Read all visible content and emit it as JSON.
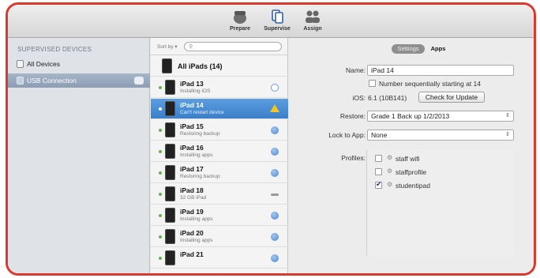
{
  "toolbar": {
    "prepare": "Prepare",
    "supervise": "Supervise",
    "assign": "Assign"
  },
  "sidebar": {
    "header": "SUPERVISED DEVICES",
    "items": [
      {
        "label": "All Devices",
        "icon": "ipad-icon",
        "selected": false
      },
      {
        "label": "USB Connection",
        "icon": "usb-icon",
        "selected": true
      }
    ]
  },
  "device_list": {
    "sort_label": "Sort by ▾",
    "search_placeholder": "",
    "header_row": "All iPads (14)",
    "devices": [
      {
        "name": "iPad 13",
        "status": "Installing iOS",
        "indicator": "spinner"
      },
      {
        "name": "iPad 14",
        "status": "Can't restart device",
        "indicator": "warning",
        "selected": true
      },
      {
        "name": "iPad 15",
        "status": "Restoring backup",
        "indicator": "blue"
      },
      {
        "name": "iPad 16",
        "status": "Installing apps",
        "indicator": "blue"
      },
      {
        "name": "iPad 17",
        "status": "Restoring backup",
        "indicator": "blue"
      },
      {
        "name": "iPad 18",
        "status": "32 GB iPad",
        "indicator": "idle"
      },
      {
        "name": "iPad 19",
        "status": "Installing apps",
        "indicator": "blue"
      },
      {
        "name": "iPad 20",
        "status": "Installing apps",
        "indicator": "blue"
      },
      {
        "name": "iPad 21",
        "status": "",
        "indicator": "blue"
      }
    ]
  },
  "detail": {
    "tabs": {
      "settings": "Settings",
      "apps": "Apps"
    },
    "name_label": "Name:",
    "name_value": "iPad 14",
    "number_seq_label": "Number sequentially starting at 14",
    "ios_label": "iOS:",
    "ios_value": "6.1 (10B141)",
    "check_update": "Check for Update",
    "restore_label": "Restore:",
    "restore_value": "Grade 1 Back up 1/2/2013",
    "lock_label": "Lock to App:",
    "lock_value": "None",
    "profiles_label": "Profiles:",
    "profiles": [
      {
        "name": "staff wifi",
        "checked": false
      },
      {
        "name": "staffprofile",
        "checked": false
      },
      {
        "name": "studentipad",
        "checked": true
      }
    ]
  },
  "colors": {
    "frame": "#d83a2e",
    "selection": "#3b7fca",
    "warning": "#f2c624"
  }
}
